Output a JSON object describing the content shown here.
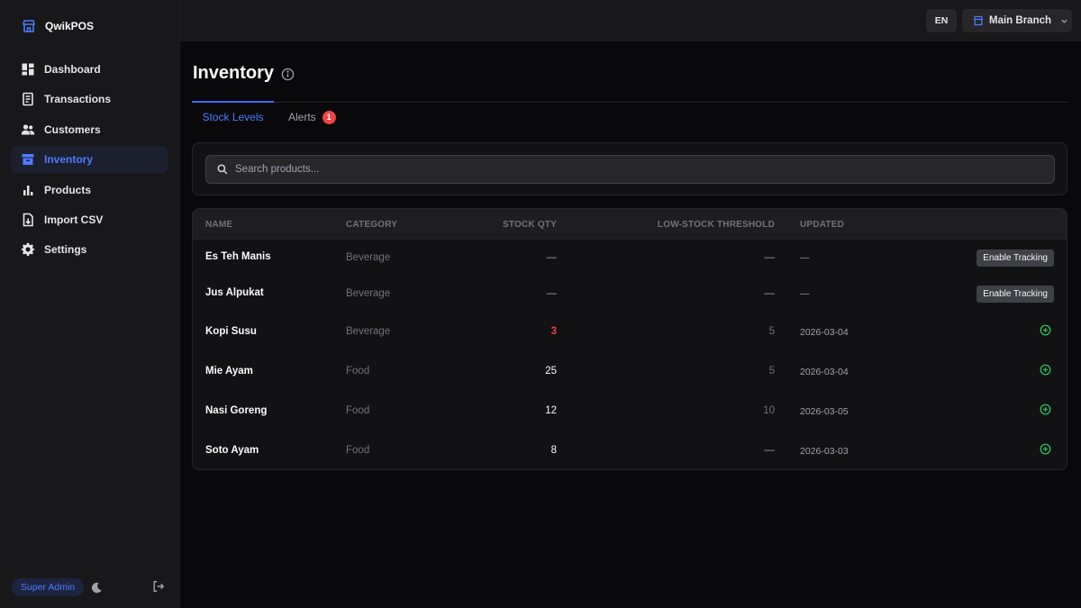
{
  "app": {
    "name": "QwikPOS"
  },
  "sidebar": {
    "items": [
      {
        "label": "Dashboard",
        "icon": "dashboard-icon"
      },
      {
        "label": "Transactions",
        "icon": "receipt-icon"
      },
      {
        "label": "Customers",
        "icon": "users-icon"
      },
      {
        "label": "Inventory",
        "icon": "archive-icon",
        "active": true
      },
      {
        "label": "Products",
        "icon": "bar-chart-icon"
      },
      {
        "label": "Import CSV",
        "icon": "file-import-icon"
      },
      {
        "label": "Settings",
        "icon": "gear-icon"
      }
    ],
    "role": "Super Admin"
  },
  "topbar": {
    "language": "EN",
    "branch": "Main Branch"
  },
  "page": {
    "title": "Inventory"
  },
  "tabs": {
    "stock_levels": "Stock Levels",
    "alerts": "Alerts",
    "alerts_count": "1"
  },
  "search": {
    "placeholder": "Search products..."
  },
  "table": {
    "headers": {
      "name": "NAME",
      "category": "CATEGORY",
      "stock_qty": "STOCK QTY",
      "threshold": "LOW-STOCK THRESHOLD",
      "updated": "UPDATED"
    },
    "enable_label": "Enable Tracking",
    "rows": [
      {
        "name": "Es Teh Manis",
        "category": "Beverage",
        "qty": "—",
        "threshold": "—",
        "updated": "—"
      },
      {
        "name": "Jus Alpukat",
        "category": "Beverage",
        "qty": "—",
        "threshold": "—",
        "updated": "—"
      },
      {
        "name": "Kopi Susu",
        "category": "Beverage",
        "qty": "3",
        "threshold": "5",
        "updated": "2026-03-04"
      },
      {
        "name": "Mie Ayam",
        "category": "Food",
        "qty": "25",
        "threshold": "5",
        "updated": "2026-03-04"
      },
      {
        "name": "Nasi Goreng",
        "category": "Food",
        "qty": "12",
        "threshold": "10",
        "updated": "2026-03-05"
      },
      {
        "name": "Soto Ayam",
        "category": "Food",
        "qty": "8",
        "threshold": "—",
        "updated": "2026-03-03"
      }
    ]
  },
  "colors": {
    "accent": "#4d7cff",
    "alert": "#ef4444",
    "success": "#22c55e"
  }
}
